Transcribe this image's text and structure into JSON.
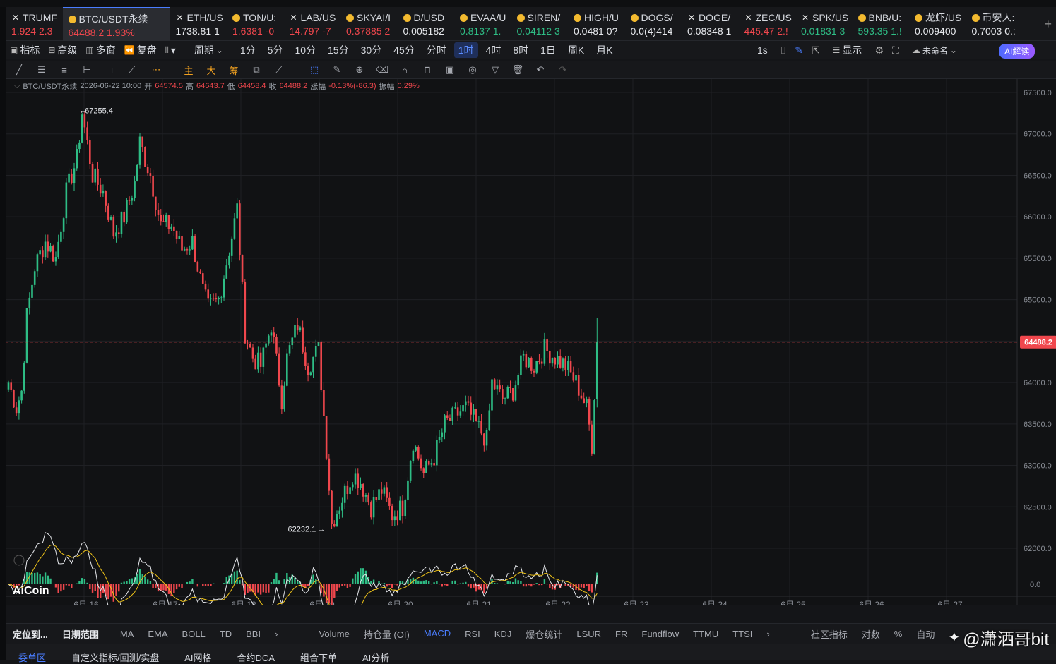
{
  "tickers": [
    {
      "icon": "x-icon",
      "name": "TRUMF",
      "price": "1.924",
      "change": "2.3",
      "dir": "dn"
    },
    {
      "icon": "coin-icon",
      "name": "BTC/USDT永续",
      "price": "64488.2",
      "change": "1.93%",
      "dir": "dn",
      "active": true
    },
    {
      "icon": "x-icon",
      "name": "ETH/US",
      "price": "1738.81",
      "change": "1",
      "dir": "wh"
    },
    {
      "icon": "coin-icon",
      "name": "TON/U:",
      "price": "1.6381",
      "change": "-0",
      "dir": "dn"
    },
    {
      "icon": "x-icon",
      "name": "LAB/US",
      "price": "14.797",
      "change": "-7",
      "dir": "dn"
    },
    {
      "icon": "coin-icon",
      "name": "SKYAI/I",
      "price": "0.37885",
      "change": "2",
      "dir": "dn"
    },
    {
      "icon": "coin-icon",
      "name": "D/USD",
      "price": "0.005182",
      "change": "",
      "dir": "wh"
    },
    {
      "icon": "coin-icon",
      "name": "EVAA/U",
      "price": "0.8137",
      "change": "1.",
      "dir": "up"
    },
    {
      "icon": "coin-icon",
      "name": "SIREN/",
      "price": "0.04112",
      "change": "3",
      "dir": "up"
    },
    {
      "icon": "coin-icon",
      "name": "HIGH/U",
      "price": "0.0481",
      "change": "0?",
      "dir": "wh"
    },
    {
      "icon": "coin-icon",
      "name": "DOGS/",
      "price": "0.0(4)414",
      "change": "",
      "dir": "wh"
    },
    {
      "icon": "x-icon",
      "name": "DOGE/",
      "price": "0.08348",
      "change": "1",
      "dir": "wh"
    },
    {
      "icon": "x-icon",
      "name": "ZEC/US",
      "price": "445.47",
      "change": "2.!",
      "dir": "dn"
    },
    {
      "icon": "x-icon",
      "name": "SPK/US",
      "price": "0.01831",
      "change": "3",
      "dir": "up"
    },
    {
      "icon": "coin-icon",
      "name": "BNB/U:",
      "price": "593.35",
      "change": "1.!",
      "dir": "up"
    },
    {
      "icon": "coin-icon",
      "name": "龙虾/US",
      "price": "0.009400",
      "change": "",
      "dir": "wh"
    },
    {
      "icon": "coin-icon",
      "name": "币安人:",
      "price": "0.7003",
      "change": "0.:",
      "dir": "wh"
    }
  ],
  "toolbar": {
    "left": [
      {
        "icon": "indicator-icon",
        "label": "指标"
      },
      {
        "icon": "advanced-icon",
        "label": "高级"
      },
      {
        "icon": "multiwindow-icon",
        "label": "多窗"
      },
      {
        "icon": "replay-icon",
        "label": "复盘"
      },
      {
        "icon": "candle-type-icon",
        "label": "▾"
      }
    ],
    "period_label": "周期",
    "periods": [
      "1分",
      "5分",
      "10分",
      "15分",
      "30分",
      "45分",
      "分时",
      "1时",
      "4时",
      "8时",
      "1日",
      "周K",
      "月K"
    ],
    "selected_period": "1时",
    "right": {
      "seconds": "1s",
      "display": "显示",
      "unnamed": "未命名",
      "ai": "AI解读"
    }
  },
  "info": {
    "symbol": "BTC/USDT永续",
    "datetime": "2026-06-22 10:00",
    "open_label": "开",
    "open": "64574.5",
    "high_label": "高",
    "high": "64643.7",
    "low_label": "低",
    "low": "64458.4",
    "close_label": "收",
    "close": "64488.2",
    "change_label": "涨幅",
    "change": "-0.13%(-86.3)",
    "amp_label": "振幅",
    "amp": "0.29%"
  },
  "chart_data": {
    "type": "candlestick",
    "interval": "1h",
    "ylim": [
      61800,
      67600
    ],
    "y_ticks": [
      "67500.0",
      "67000.0",
      "66500.0",
      "66000.0",
      "65500.0",
      "65000.0",
      "64500.0",
      "64000.0",
      "63500.0",
      "63000.0",
      "62500.0",
      "62000.0"
    ],
    "x_ticks": [
      "6月 16",
      "6月 17",
      "6月 18",
      "6月 19",
      "6月 20",
      "6月 21",
      "6月 22",
      "6月 23",
      "6月 24",
      "6月 25",
      "6月 26",
      "6月 27"
    ],
    "current_price": "64488.2",
    "max_label": "67255.4",
    "min_label": "62232.1",
    "macd_zero": "0.0",
    "up_color": "#2ebd85",
    "down_color": "#f0474d",
    "anchors": [
      [
        0,
        64000
      ],
      [
        3,
        63700
      ],
      [
        5,
        63900
      ],
      [
        7,
        64800
      ],
      [
        10,
        65400
      ],
      [
        14,
        65700
      ],
      [
        18,
        65500
      ],
      [
        22,
        66300
      ],
      [
        26,
        66700
      ],
      [
        28,
        67255
      ],
      [
        32,
        66500
      ],
      [
        36,
        66300
      ],
      [
        40,
        65800
      ],
      [
        44,
        66000
      ],
      [
        48,
        66400
      ],
      [
        50,
        66900
      ],
      [
        54,
        66500
      ],
      [
        58,
        65900
      ],
      [
        62,
        65900
      ],
      [
        66,
        65600
      ],
      [
        70,
        65700
      ],
      [
        74,
        65100
      ],
      [
        76,
        64900
      ],
      [
        80,
        65000
      ],
      [
        84,
        65600
      ],
      [
        87,
        66100
      ],
      [
        90,
        64600
      ],
      [
        93,
        64300
      ],
      [
        96,
        64200
      ],
      [
        100,
        64700
      ],
      [
        104,
        63800
      ],
      [
        106,
        64300
      ],
      [
        110,
        64700
      ],
      [
        114,
        64200
      ],
      [
        118,
        64400
      ],
      [
        121,
        63200
      ],
      [
        123,
        62300
      ],
      [
        127,
        62600
      ],
      [
        131,
        62900
      ],
      [
        134,
        62800
      ],
      [
        138,
        62500
      ],
      [
        142,
        62700
      ],
      [
        146,
        62400
      ],
      [
        150,
        62500
      ],
      [
        154,
        63300
      ],
      [
        158,
        62900
      ],
      [
        162,
        63100
      ],
      [
        166,
        63500
      ],
      [
        170,
        63600
      ],
      [
        174,
        63700
      ],
      [
        178,
        63500
      ],
      [
        182,
        63300
      ],
      [
        184,
        64000
      ],
      [
        188,
        63800
      ],
      [
        192,
        63900
      ],
      [
        196,
        64300
      ],
      [
        200,
        64200
      ],
      [
        204,
        64400
      ],
      [
        208,
        64300
      ],
      [
        212,
        64200
      ],
      [
        216,
        64000
      ],
      [
        220,
        63700
      ],
      [
        222,
        63250
      ],
      [
        224,
        64500
      ]
    ],
    "point_count": 225
  },
  "bottom_tabs": [
    "定位到...",
    "日期范围",
    "MA",
    "EMA",
    "BOLL",
    "TD",
    "BBI",
    "Volume",
    "持仓量 (OI)",
    "MACD",
    "RSI",
    "KDJ",
    "爆仓统计",
    "LSUR",
    "FR",
    "Fundflow",
    "TTMU",
    "TTSI",
    "社区指标",
    "对数",
    "%",
    "自动"
  ],
  "selected_bottom": "MACD",
  "last_tabs": [
    "委单区",
    "自定义指标/回测/实盘",
    "AI网格",
    "合约DCA",
    "组合下单",
    "AI分析"
  ],
  "watermark": {
    "logo": "AiCoin",
    "text": "@潇洒哥bit"
  }
}
